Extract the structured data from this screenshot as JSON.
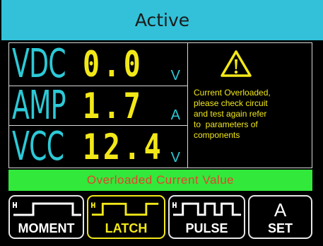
{
  "header": {
    "title": "Active"
  },
  "readouts": [
    {
      "label": "VDC",
      "value": "0.0",
      "unit": "V"
    },
    {
      "label": "AMP",
      "value": "1.7",
      "unit": "A"
    },
    {
      "label": "VCC",
      "value": "12.4",
      "unit": "V"
    }
  ],
  "warning": {
    "icon": "warning-icon",
    "lines": [
      "Current Overloaded,",
      "please check circuit",
      "and test again refer",
      "to  parameters of",
      "components"
    ]
  },
  "status_bar": {
    "text": "Overloaded Current Value"
  },
  "mode_buttons": [
    {
      "label": "MOMENT",
      "icon": "moment-wave-icon"
    },
    {
      "label": "LATCH",
      "icon": "latch-wave-icon"
    },
    {
      "label": "PULSE",
      "icon": "pulse-wave-icon"
    },
    {
      "top": "A",
      "label": "SET"
    }
  ],
  "colors": {
    "header_bg": "#32c1d9",
    "label_cyan": "#2cc9d6",
    "value_yellow": "#f2e818",
    "status_green": "#32e83b",
    "status_text_red": "#e8412e"
  }
}
